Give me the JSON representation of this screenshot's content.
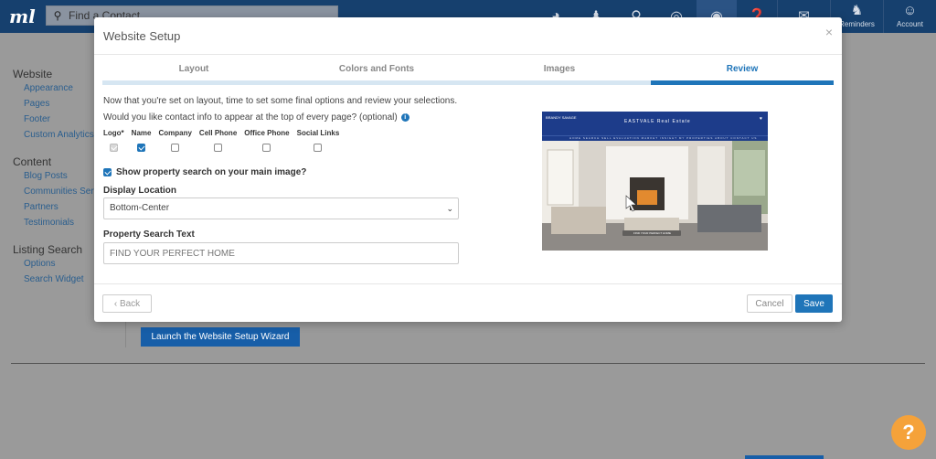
{
  "topbar": {
    "logo": "ml",
    "search_placeholder": "Find a Contact",
    "reminders_label": "Reminders",
    "account_label": "Account"
  },
  "left_nav": {
    "sections": [
      {
        "title": "Website",
        "items": [
          "Appearance",
          "Pages",
          "Footer",
          "Custom Analytics"
        ]
      },
      {
        "title": "Content",
        "items": [
          "Blog Posts",
          "Communities Served",
          "Partners",
          "Testimonials"
        ]
      },
      {
        "title": "Listing Search",
        "items": [
          "Options",
          "Search Widget"
        ]
      }
    ]
  },
  "page": {
    "launch_button": "Launch the Website Setup Wizard",
    "help_glyph": "?"
  },
  "modal": {
    "title": "Website Setup",
    "close_glyph": "×",
    "steps": [
      {
        "label": "Layout",
        "active": false
      },
      {
        "label": "Colors and Fonts",
        "active": false
      },
      {
        "label": "Images",
        "active": false
      },
      {
        "label": "Review",
        "active": true
      }
    ],
    "intro_text": "Now that you're set on layout, time to set some final options and review your selections.",
    "contact_question": "Would you like contact info to appear at the top of every page? (optional)",
    "contact_options": [
      {
        "label": "Logo*",
        "state": "disabled-checked"
      },
      {
        "label": "Name",
        "state": "checked"
      },
      {
        "label": "Company",
        "state": "unchecked"
      },
      {
        "label": "Cell Phone",
        "state": "unchecked"
      },
      {
        "label": "Office Phone",
        "state": "unchecked"
      },
      {
        "label": "Social Links",
        "state": "unchecked"
      }
    ],
    "show_search_label": "Show property search on your main image?",
    "show_search_checked": true,
    "display_location_label": "Display Location",
    "display_location_value": "Bottom-Center",
    "search_text_label": "Property Search Text",
    "search_text_placeholder": "FIND YOUR PERFECT HOME",
    "preview": {
      "brand": "BRANDY SAVAGE",
      "site_title": "EASTVALE Real Estate",
      "nav_text": "HOME  SEARCH  SELL  EVALUATION  MARKET INSIGHT  MY PROPERTIES  ABOUT  CONTACT US",
      "search_bar_text": "FIND YOUR PERFECT HOME"
    },
    "back_label": "Back",
    "cancel_label": "Cancel",
    "save_label": "Save"
  },
  "colors": {
    "topbar": "#16406e",
    "accent": "#1f75b9",
    "help": "#f5a23a"
  },
  "icons": [
    "logo-mark",
    "search-icon",
    "dashboard-icon",
    "people-icon",
    "map-pin-icon",
    "target-icon",
    "globe-icon",
    "help-icon",
    "mail-icon",
    "reminders-icon",
    "account-icon",
    "close-icon",
    "info-icon",
    "chevron-down-icon",
    "chevron-left-icon"
  ]
}
